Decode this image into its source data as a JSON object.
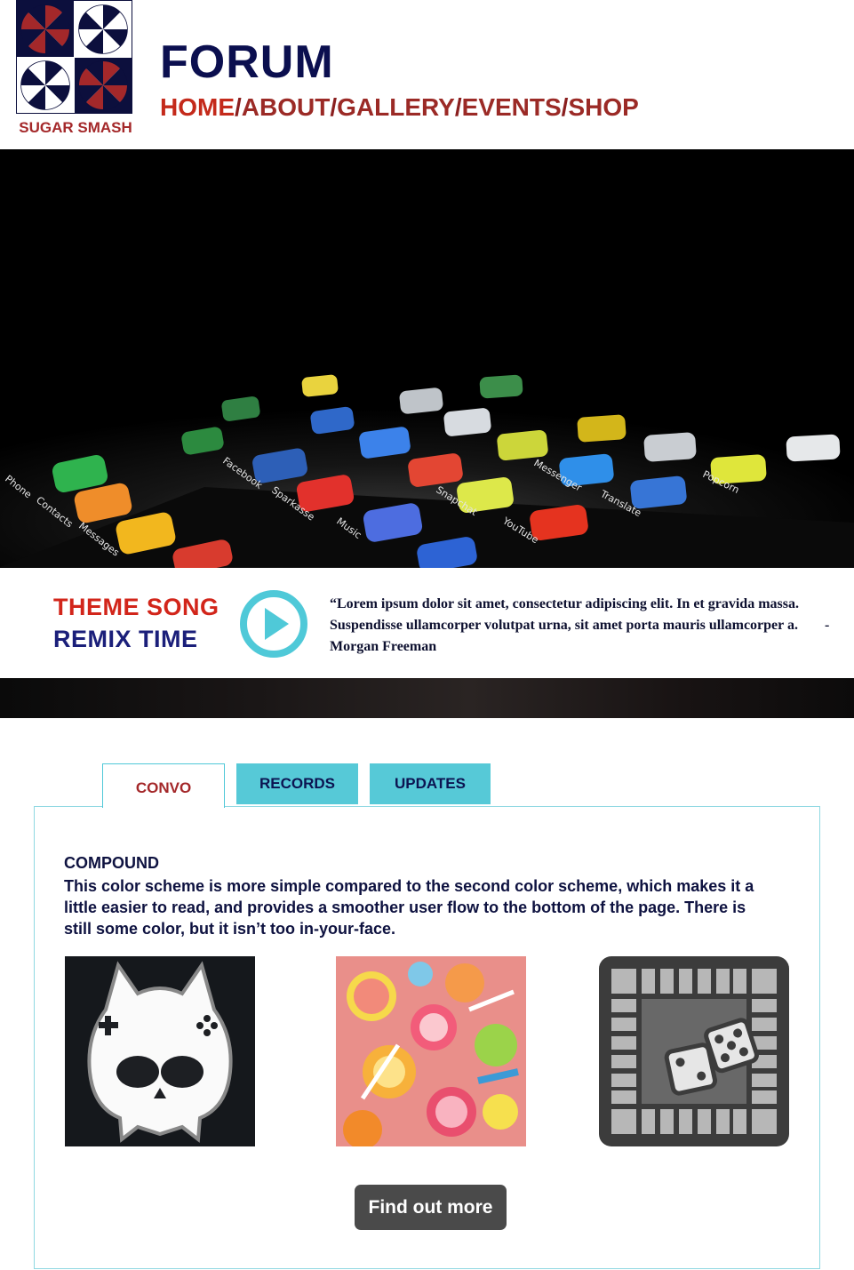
{
  "header": {
    "logo_text": "SUGAR SMASH",
    "title": "FORUM",
    "nav": [
      "HOME",
      "ABOUT",
      "GALLERY",
      "EVENTS",
      "SHOP"
    ],
    "nav_separator": "/"
  },
  "hero": {
    "app_labels": [
      "Phone",
      "Contacts",
      "Messages",
      "Facebook",
      "Sparkasse",
      "Music",
      "Snapchat",
      "YouTube",
      "Messenger",
      "Translate",
      "Popcorn"
    ]
  },
  "theme": {
    "line1": "THEME SONG",
    "line2": "REMIX TIME",
    "quote": "“Lorem ipsum dolor sit amet, consectetur adipiscing elit. In et gravida massa. Suspendisse ullamcorper volutpat urna, sit amet porta mauris ullamcorper a.",
    "author": "- Morgan Freeman"
  },
  "tabs": [
    {
      "label": "CONVO",
      "active": true
    },
    {
      "label": "RECORDS",
      "active": false
    },
    {
      "label": "UPDATES",
      "active": false
    }
  ],
  "panel": {
    "heading": "COMPOUND",
    "text": "This color scheme is more simple compared to the second color scheme, which makes it a little easier to read, and provides a smoother user flow to the bottom of the page. There is still some color, but it isn’t too in-your-face.",
    "button_label": "Find out more"
  },
  "colors": {
    "navy": "#0b0f4f",
    "red": "#c42a1b",
    "maroon": "#9b2a26",
    "teal": "#56c9d7",
    "button_gray": "#4a4a4a"
  },
  "icons": {
    "logo": "pinwheel-candy-icon",
    "play": "play-circle-icon",
    "thumb1": "gaming-skull-icon",
    "thumb2": "candy-photo",
    "thumb3": "board-game-dice-icon"
  }
}
